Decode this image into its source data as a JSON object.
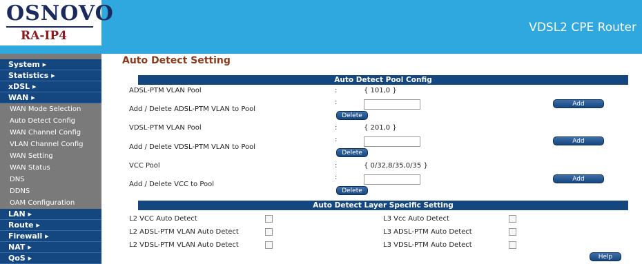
{
  "header": {
    "logo_main": "OSNOVO",
    "logo_sub": "RA-IP4",
    "product": "VDSL2 CPE Router"
  },
  "sidebar": {
    "items": [
      {
        "label": "System ▸",
        "type": "main"
      },
      {
        "label": "Statistics ▸",
        "type": "main"
      },
      {
        "label": "xDSL ▸",
        "type": "main"
      },
      {
        "label": "WAN ▸",
        "type": "main"
      },
      {
        "label": "WAN Mode Selection",
        "type": "sub"
      },
      {
        "label": "Auto Detect Config",
        "type": "sub"
      },
      {
        "label": "WAN Channel Config",
        "type": "sub"
      },
      {
        "label": "VLAN Channel Config",
        "type": "sub"
      },
      {
        "label": "WAN Setting",
        "type": "sub"
      },
      {
        "label": "WAN Status",
        "type": "sub"
      },
      {
        "label": "DNS",
        "type": "sub"
      },
      {
        "label": "DDNS",
        "type": "sub"
      },
      {
        "label": "OAM Configuration",
        "type": "sub"
      },
      {
        "label": "LAN ▸",
        "type": "main"
      },
      {
        "label": "Route ▸",
        "type": "main"
      },
      {
        "label": "Firewall ▸",
        "type": "main"
      },
      {
        "label": "NAT ▸",
        "type": "main"
      },
      {
        "label": "QoS ▸",
        "type": "main"
      }
    ]
  },
  "main": {
    "title": "Auto Detect Setting",
    "pool_section": {
      "heading": "Auto Detect Pool Config",
      "rows": [
        {
          "label": "ADSL-PTM VLAN Pool",
          "colon": ":",
          "value": "{ 101,0 }"
        },
        {
          "label": "Add / Delete ADSL-PTM VLAN to Pool",
          "colon": ":",
          "input_value": "",
          "delete_label": "Delete",
          "add_label": "Add"
        },
        {
          "label": "VDSL-PTM VLAN Pool",
          "colon": ":",
          "value": "{ 201,0 }"
        },
        {
          "label": "Add / Delete VDSL-PTM VLAN to Pool",
          "colon": ":",
          "input_value": "",
          "delete_label": "Delete",
          "add_label": "Add"
        },
        {
          "label": "VCC Pool",
          "colon": ":",
          "value": "{ 0/32,8/35,0/35 }"
        },
        {
          "label": "Add / Delete VCC to Pool",
          "colon": ":",
          "input_value": "",
          "delete_label": "Delete",
          "add_label": "Add"
        }
      ]
    },
    "layer_section": {
      "heading": "Auto Detect Layer Specific Setting",
      "left": [
        {
          "label": "L2 VCC Auto Detect",
          "checked": false
        },
        {
          "label": "L2 ADSL-PTM VLAN Auto Detect",
          "checked": false
        },
        {
          "label": "L2 VDSL-PTM VLAN Auto Detect",
          "checked": false
        }
      ],
      "right": [
        {
          "label": "L3 Vcc Auto Detect",
          "checked": false
        },
        {
          "label": "L3 ADSL-PTM Auto Detect",
          "checked": false
        },
        {
          "label": "L3 VDSL-PTM Auto Detect",
          "checked": false
        }
      ]
    },
    "help_label": "Help"
  },
  "colors": {
    "header_bg": "#2fa8df",
    "nav_main_bg": "#14467f",
    "nav_sub_bg": "#7a7a7a",
    "title_color": "#8c3a1a"
  }
}
